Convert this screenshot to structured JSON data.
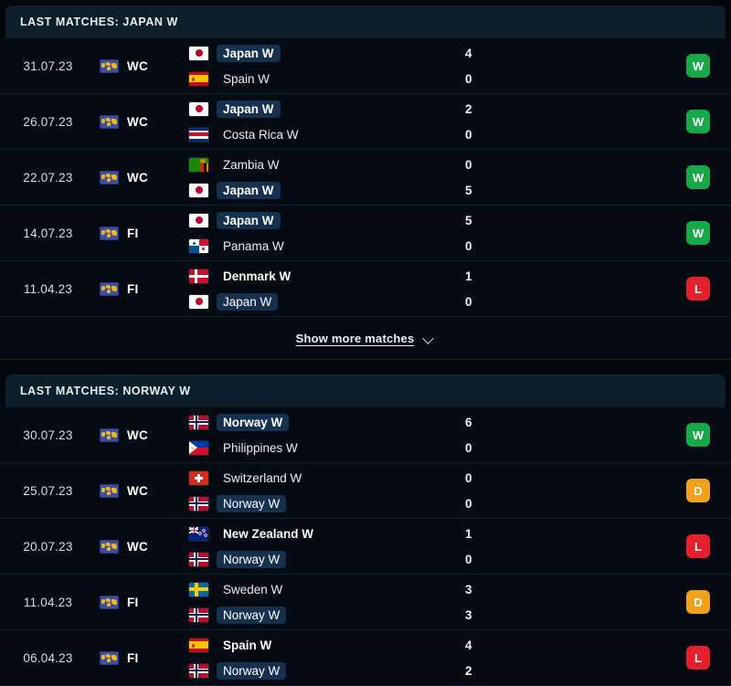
{
  "sections": [
    {
      "header": "LAST MATCHES: JAPAN W",
      "focus_team": "Japan W",
      "show_more": {
        "label": "Show more matches",
        "icon": "chevron-down-icon"
      },
      "matches": [
        {
          "date": "31.07.23",
          "competition": "WC",
          "competition_icon": "world-map-icon",
          "home": {
            "name": "Japan W",
            "flag": "jp",
            "bold": true,
            "highlight": true
          },
          "away": {
            "name": "Spain W",
            "flag": "es",
            "bold": false,
            "highlight": false
          },
          "home_score": "4",
          "away_score": "0",
          "result": "W"
        },
        {
          "date": "26.07.23",
          "competition": "WC",
          "competition_icon": "world-map-icon",
          "home": {
            "name": "Japan W",
            "flag": "jp",
            "bold": true,
            "highlight": true
          },
          "away": {
            "name": "Costa Rica W",
            "flag": "cr",
            "bold": false,
            "highlight": false
          },
          "home_score": "2",
          "away_score": "0",
          "result": "W"
        },
        {
          "date": "22.07.23",
          "competition": "WC",
          "competition_icon": "world-map-icon",
          "home": {
            "name": "Zambia W",
            "flag": "zm",
            "bold": false,
            "highlight": false
          },
          "away": {
            "name": "Japan W",
            "flag": "jp",
            "bold": true,
            "highlight": true
          },
          "home_score": "0",
          "away_score": "5",
          "result": "W"
        },
        {
          "date": "14.07.23",
          "competition": "FI",
          "competition_icon": "world-map-icon",
          "home": {
            "name": "Japan W",
            "flag": "jp",
            "bold": true,
            "highlight": true
          },
          "away": {
            "name": "Panama W",
            "flag": "pa",
            "bold": false,
            "highlight": false
          },
          "home_score": "5",
          "away_score": "0",
          "result": "W"
        },
        {
          "date": "11.04.23",
          "competition": "FI",
          "competition_icon": "world-map-icon",
          "home": {
            "name": "Denmark W",
            "flag": "dk",
            "bold": true,
            "highlight": false
          },
          "away": {
            "name": "Japan W",
            "flag": "jp",
            "bold": false,
            "highlight": true
          },
          "home_score": "1",
          "away_score": "0",
          "result": "L"
        }
      ]
    },
    {
      "header": "LAST MATCHES: NORWAY W",
      "focus_team": "Norway W",
      "show_more": null,
      "matches": [
        {
          "date": "30.07.23",
          "competition": "WC",
          "competition_icon": "world-map-icon",
          "home": {
            "name": "Norway W",
            "flag": "no",
            "bold": true,
            "highlight": true
          },
          "away": {
            "name": "Philippines W",
            "flag": "ph",
            "bold": false,
            "highlight": false
          },
          "home_score": "6",
          "away_score": "0",
          "result": "W"
        },
        {
          "date": "25.07.23",
          "competition": "WC",
          "competition_icon": "world-map-icon",
          "home": {
            "name": "Switzerland W",
            "flag": "ch",
            "bold": false,
            "highlight": false
          },
          "away": {
            "name": "Norway W",
            "flag": "no",
            "bold": false,
            "highlight": true
          },
          "home_score": "0",
          "away_score": "0",
          "result": "D"
        },
        {
          "date": "20.07.23",
          "competition": "WC",
          "competition_icon": "world-map-icon",
          "home": {
            "name": "New Zealand W",
            "flag": "nz",
            "bold": true,
            "highlight": false
          },
          "away": {
            "name": "Norway W",
            "flag": "no",
            "bold": false,
            "highlight": true
          },
          "home_score": "1",
          "away_score": "0",
          "result": "L"
        },
        {
          "date": "11.04.23",
          "competition": "FI",
          "competition_icon": "world-map-icon",
          "home": {
            "name": "Sweden W",
            "flag": "se",
            "bold": false,
            "highlight": false
          },
          "away": {
            "name": "Norway W",
            "flag": "no",
            "bold": false,
            "highlight": true
          },
          "home_score": "3",
          "away_score": "3",
          "result": "D"
        },
        {
          "date": "06.04.23",
          "competition": "FI",
          "competition_icon": "world-map-icon",
          "home": {
            "name": "Spain W",
            "flag": "es",
            "bold": true,
            "highlight": false
          },
          "away": {
            "name": "Norway W",
            "flag": "no",
            "bold": false,
            "highlight": true
          },
          "home_score": "4",
          "away_score": "2",
          "result": "L"
        }
      ]
    }
  ],
  "colors": {
    "win": "#17a84a",
    "draw": "#efa11c",
    "loss": "#e3202c",
    "highlight_pill": "#15314e",
    "header_bg": "#0b2029",
    "row_bg": "#040b12",
    "page_bg": "#02070c"
  }
}
